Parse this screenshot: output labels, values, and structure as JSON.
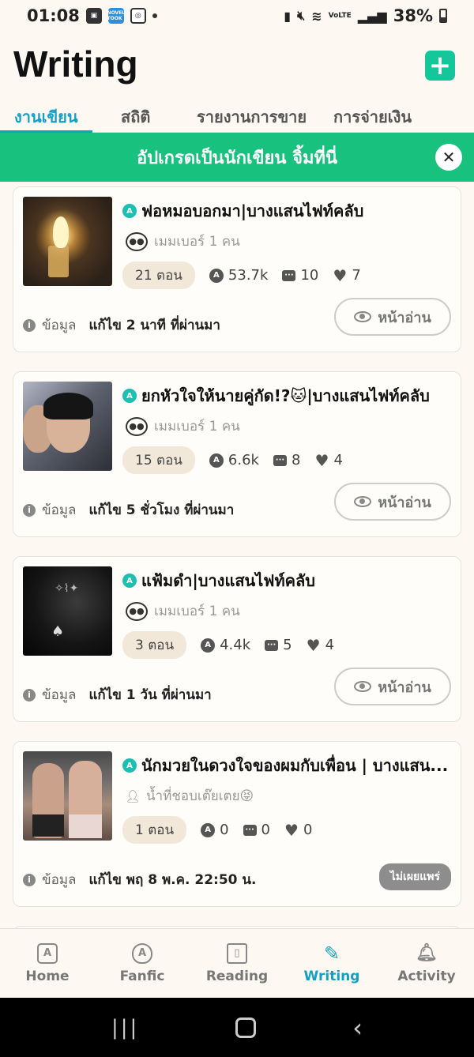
{
  "status_bar": {
    "time": "01:08",
    "novel_badge": "NOVEL TOOK",
    "lte": "VoLTE",
    "battery": "38%"
  },
  "header": {
    "title": "Writing"
  },
  "tabs": [
    {
      "label": "งานเขียน"
    },
    {
      "label": "สถิติ"
    },
    {
      "label": "รายงานการขาย"
    },
    {
      "label": "การจ่ายเงิน"
    }
  ],
  "promo": {
    "text": "อัปเกรดเป็นนักเขียน จิ้มที่นี่"
  },
  "stories": [
    {
      "title": "ฟอหมอบอกมา|บางแสนไฟท์คลับ",
      "members": "เมมเบอร์ 1 คน",
      "chapters": "21 ตอน",
      "views": "53.7k",
      "comments": "10",
      "likes": "7",
      "info_label": "ข้อมูล",
      "edited": "แก้ไข 2 นาที ที่ผ่านมา",
      "read_label": "หน้าอ่าน"
    },
    {
      "title": "ยกหัวใจให้นายคู่กัด!?🐱|บางแสนไฟท์คลับ",
      "members": "เมมเบอร์ 1 คน",
      "chapters": "15 ตอน",
      "views": "6.6k",
      "comments": "8",
      "likes": "4",
      "info_label": "ข้อมูล",
      "edited": "แก้ไข 5 ชั่วโมง ที่ผ่านมา",
      "read_label": "หน้าอ่าน"
    },
    {
      "title": "แฟ้มดำ|บางแสนไฟท์คลับ",
      "members": "เมมเบอร์ 1 คน",
      "chapters": "3 ตอน",
      "views": "4.4k",
      "comments": "5",
      "likes": "4",
      "info_label": "ข้อมูล",
      "edited": "แก้ไข 1 วัน ที่ผ่านมา",
      "read_label": "หน้าอ่าน"
    },
    {
      "title": "นักมวยในดวงใจของผมกับเพื่อน | บางแสน...",
      "author": "น้ำที่ชอบเต๊ยเตย😝",
      "chapters": "1 ตอน",
      "views": "0",
      "comments": "0",
      "likes": "0",
      "info_label": "ข้อมูล",
      "edited": "แก้ไข พฤ 8 พ.ค. 22:50 น.",
      "status_badge": "ไม่เผยแพร่"
    }
  ],
  "bottom_nav": [
    {
      "label": "Home",
      "icon": "a-box-icon"
    },
    {
      "label": "Fanfic",
      "icon": "a-shield-icon"
    },
    {
      "label": "Reading",
      "icon": "book-icon"
    },
    {
      "label": "Writing",
      "icon": "pencil-icon"
    },
    {
      "label": "Activity",
      "icon": "bell-icon"
    }
  ],
  "colors": {
    "accent": "#14a0c4",
    "promo_green": "#19c17f",
    "add_button": "#14c79a",
    "background": "#fdf8f2"
  }
}
